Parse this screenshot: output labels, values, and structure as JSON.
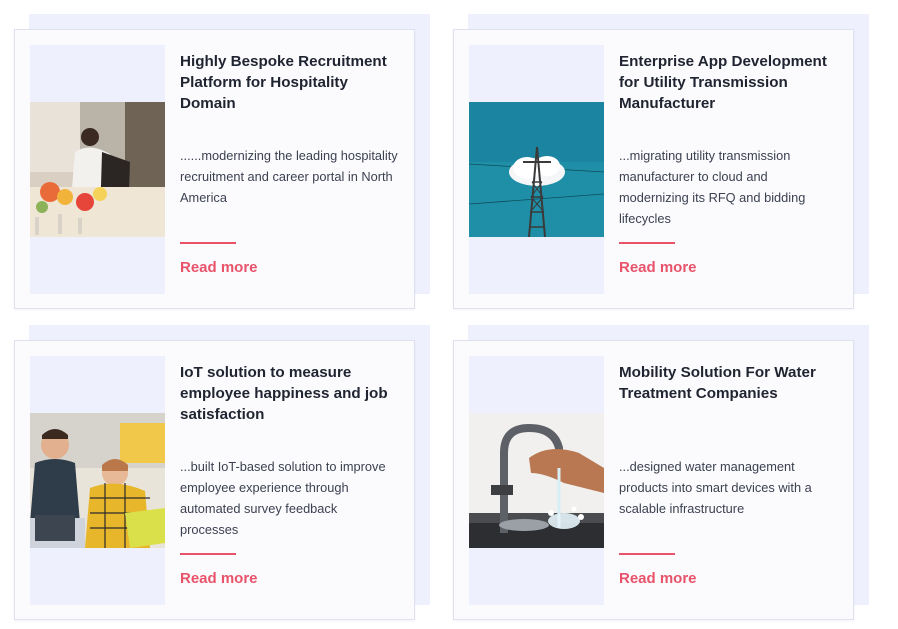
{
  "cards": [
    {
      "title": "Highly Bespoke Recruitment Platform for Hospitality Domain",
      "description": "......modernizing the leading hospitality recruitment and career portal in North America",
      "link_label": "Read more"
    },
    {
      "title": "Enterprise App Development for Utility Transmission Manufacturer",
      "description": "...migrating utility transmission manufacturer to cloud and modernizing its RFQ and bidding lifecycles",
      "link_label": "Read more"
    },
    {
      "title": "IoT solution to measure employee happiness and job satisfaction",
      "description": "...built IoT-based solution to improve employee experience through automated survey feedback processes",
      "link_label": "Read more"
    },
    {
      "title": "Mobility Solution For Water Treatment Companies",
      "description": "...designed water management products into smart devices with a scalable infrastructure",
      "link_label": "Read more"
    }
  ],
  "colors": {
    "accent": "#e8536a",
    "panel": "#eef1fd",
    "title": "#1f2430",
    "text": "#3c4150"
  }
}
